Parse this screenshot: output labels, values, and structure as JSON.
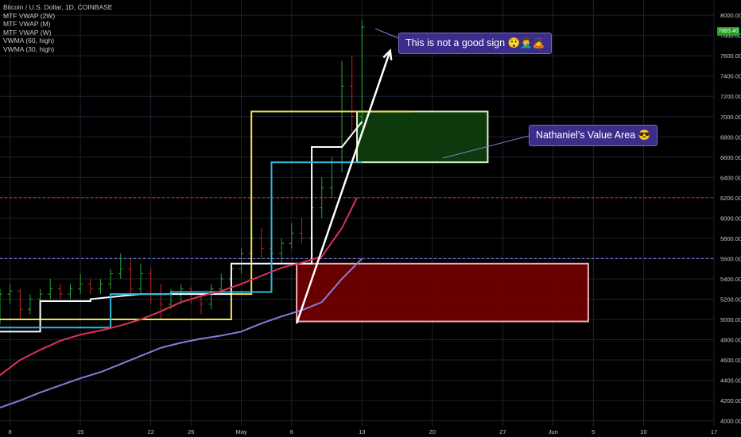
{
  "symbol_title": "Bitcoin / U.S. Dollar, 1D, COINBASE",
  "indicators": [
    "MTF VWAP (2W)",
    "MTF VWAP (M)",
    "MTF VWAP (W)",
    "VWMA (60, high)",
    "VWMA (30, high)"
  ],
  "last_price_label": "7883.40",
  "annotations": {
    "sign_text": "This is not a good sign 😲🤦‍♂️🙇",
    "value_area_text": "Nathaniel's Value Area 😎"
  },
  "colors": {
    "background": "#000000",
    "grid": "#1e2230",
    "candle_up": "#26a63a",
    "candle_down": "#c0282a",
    "vwap_2w": "#f4e34b",
    "vwap_m": "#ffffff",
    "vwap_w": "#2fb8d8",
    "vwma_60": "#8a7ad8",
    "vwma_30": "#e0305a",
    "value_area_fill": "#0d3a0d",
    "value_area_border": "#d8f0c8",
    "red_zone_fill": "#7a0000",
    "red_zone_border": "#f0b0b0",
    "hline_red": "#e0304a",
    "hline_blue": "#8080ff",
    "arrow": "#ffffff"
  },
  "chart_data": {
    "type": "line",
    "title": "Bitcoin / U.S. Dollar, 1D, COINBASE",
    "x_range_day": [
      -24,
      47
    ],
    "y_range": [
      3950,
      8150
    ],
    "y_ticks": [
      4000,
      4200,
      4400,
      4600,
      4800,
      5000,
      5200,
      5400,
      5600,
      5800,
      6000,
      6200,
      6400,
      6600,
      6800,
      7000,
      7200,
      7400,
      7600,
      7800,
      8000
    ],
    "x_ticks": [
      {
        "label": "8",
        "day": -23
      },
      {
        "label": "15",
        "day": -16
      },
      {
        "label": "22",
        "day": -9
      },
      {
        "label": "26",
        "day": -5
      },
      {
        "label": "May",
        "day": 0
      },
      {
        "label": "6",
        "day": 5
      },
      {
        "label": "13",
        "day": 12
      },
      {
        "label": "20",
        "day": 19
      },
      {
        "label": "27",
        "day": 26
      },
      {
        "label": "Jun",
        "day": 31
      },
      {
        "label": "5",
        "day": 35
      },
      {
        "label": "10",
        "day": 40
      },
      {
        "label": "17",
        "day": 47
      }
    ],
    "candles": [
      {
        "o": 4900,
        "h": 5050,
        "l": 4850,
        "c": 5000
      },
      {
        "o": 5000,
        "h": 5250,
        "l": 4950,
        "c": 5150
      },
      {
        "o": 5150,
        "h": 5300,
        "l": 5050,
        "c": 5200
      },
      {
        "o": 5200,
        "h": 5500,
        "l": 5100,
        "c": 5350
      },
      {
        "o": 5350,
        "h": 5450,
        "l": 5100,
        "c": 5150
      },
      {
        "o": 5150,
        "h": 5250,
        "l": 5050,
        "c": 5200
      },
      {
        "o": 5200,
        "h": 5400,
        "l": 5100,
        "c": 5300
      },
      {
        "o": 5300,
        "h": 5350,
        "l": 5000,
        "c": 5100
      },
      {
        "o": 5100,
        "h": 5300,
        "l": 4950,
        "c": 5250
      },
      {
        "o": 5250,
        "h": 5350,
        "l": 5150,
        "c": 5280
      },
      {
        "o": 5280,
        "h": 5300,
        "l": 5000,
        "c": 5100
      },
      {
        "o": 5100,
        "h": 5250,
        "l": 5050,
        "c": 5200
      },
      {
        "o": 5200,
        "h": 5300,
        "l": 5150,
        "c": 5250
      },
      {
        "o": 5250,
        "h": 5400,
        "l": 5200,
        "c": 5300
      },
      {
        "o": 5300,
        "h": 5350,
        "l": 5200,
        "c": 5250
      },
      {
        "o": 5250,
        "h": 5350,
        "l": 5200,
        "c": 5300
      },
      {
        "o": 5300,
        "h": 5450,
        "l": 5250,
        "c": 5350
      },
      {
        "o": 5350,
        "h": 5400,
        "l": 5250,
        "c": 5300
      },
      {
        "o": 5300,
        "h": 5400,
        "l": 5250,
        "c": 5350
      },
      {
        "o": 5350,
        "h": 5500,
        "l": 5300,
        "c": 5450
      },
      {
        "o": 5450,
        "h": 5650,
        "l": 5400,
        "c": 5500
      },
      {
        "o": 5500,
        "h": 5600,
        "l": 5250,
        "c": 5300
      },
      {
        "o": 5300,
        "h": 5550,
        "l": 5250,
        "c": 5450
      },
      {
        "o": 5450,
        "h": 5500,
        "l": 5150,
        "c": 5250
      },
      {
        "o": 5250,
        "h": 5350,
        "l": 5000,
        "c": 5150
      },
      {
        "o": 5150,
        "h": 5300,
        "l": 5100,
        "c": 5250
      },
      {
        "o": 5250,
        "h": 5350,
        "l": 5150,
        "c": 5300
      },
      {
        "o": 5300,
        "h": 5320,
        "l": 5150,
        "c": 5200
      },
      {
        "o": 5200,
        "h": 5250,
        "l": 5050,
        "c": 5150
      },
      {
        "o": 5150,
        "h": 5350,
        "l": 5100,
        "c": 5300
      },
      {
        "o": 5300,
        "h": 5450,
        "l": 5250,
        "c": 5400
      },
      {
        "o": 5400,
        "h": 5550,
        "l": 5350,
        "c": 5500
      },
      {
        "o": 5500,
        "h": 5700,
        "l": 5450,
        "c": 5650
      },
      {
        "o": 5650,
        "h": 5850,
        "l": 5600,
        "c": 5800
      },
      {
        "o": 5800,
        "h": 5900,
        "l": 5600,
        "c": 5700
      },
      {
        "o": 5700,
        "h": 5800,
        "l": 5550,
        "c": 5650
      },
      {
        "o": 5650,
        "h": 5800,
        "l": 5550,
        "c": 5750
      },
      {
        "o": 5750,
        "h": 5950,
        "l": 5700,
        "c": 5850
      },
      {
        "o": 5850,
        "h": 6000,
        "l": 5750,
        "c": 5800
      },
      {
        "o": 5800,
        "h": 6150,
        "l": 5750,
        "c": 6100
      },
      {
        "o": 6100,
        "h": 6400,
        "l": 6000,
        "c": 6300
      },
      {
        "o": 6300,
        "h": 6600,
        "l": 6200,
        "c": 6550
      },
      {
        "o": 6550,
        "h": 7550,
        "l": 6450,
        "c": 7300
      },
      {
        "o": 7300,
        "h": 7600,
        "l": 6850,
        "c": 7000
      },
      {
        "o": 7000,
        "h": 7950,
        "l": 6900,
        "c": 7883
      }
    ],
    "series": [
      {
        "name": "MTF VWAP (2W)",
        "x": [
          -24,
          -6,
          -6,
          -1,
          -1,
          1,
          1,
          17
        ],
        "values": [
          5000,
          5000,
          5000,
          5000,
          5250,
          5250,
          7050,
          7050
        ]
      },
      {
        "name": "MTF VWAP (M)",
        "x": [
          -24,
          -20,
          -20,
          -15,
          -15,
          -10,
          -5,
          -1,
          -1,
          4,
          4,
          7,
          7,
          10,
          10,
          12
        ],
        "values": [
          4880,
          4880,
          5180,
          5180,
          5200,
          5250,
          5250,
          5250,
          5550,
          5550,
          5550,
          5550,
          6700,
          6700,
          6700,
          6950
        ]
      },
      {
        "name": "MTF VWAP (W)",
        "x": [
          -24,
          -13,
          -13,
          -7,
          -7,
          -3,
          -3,
          3,
          3,
          10,
          10,
          11,
          11,
          12
        ],
        "values": [
          4920,
          4920,
          5250,
          5250,
          5270,
          5270,
          5270,
          5270,
          6550,
          6550,
          6550,
          6550,
          6550,
          6550
        ]
      },
      {
        "name": "VWMA (60, high)",
        "x": [
          -24,
          -22,
          -20,
          -18,
          -16,
          -14,
          -12,
          -10,
          -8,
          -6,
          -4,
          -2,
          0,
          2,
          4,
          6,
          8,
          10,
          12
        ],
        "values": [
          4130,
          4200,
          4280,
          4350,
          4420,
          4480,
          4560,
          4640,
          4720,
          4770,
          4810,
          4840,
          4880,
          4960,
          5030,
          5090,
          5170,
          5400,
          5600
        ]
      },
      {
        "name": "VWMA (30, high)",
        "x": [
          -24,
          -22,
          -20,
          -18,
          -16,
          -14,
          -12,
          -10,
          -8,
          -6,
          -4,
          -2,
          0,
          2,
          4,
          6,
          8,
          10,
          11.5
        ],
        "values": [
          4450,
          4600,
          4700,
          4790,
          4850,
          4890,
          4940,
          5000,
          5080,
          5170,
          5230,
          5280,
          5350,
          5430,
          5510,
          5560,
          5620,
          5900,
          6200
        ]
      }
    ],
    "horizontal_lines": [
      6200,
      5600
    ],
    "value_area": {
      "x": [
        11.5,
        24.5
      ],
      "y": [
        6550,
        7050
      ]
    },
    "red_zone": {
      "x": [
        5.5,
        34.5
      ],
      "y": [
        4980,
        5550
      ]
    },
    "arrow": {
      "x": [
        5.5,
        14.8
      ],
      "y": [
        4960,
        7650
      ]
    }
  }
}
